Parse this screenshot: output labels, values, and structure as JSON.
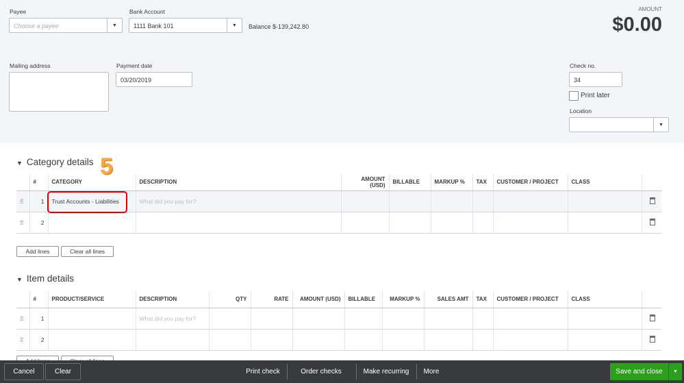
{
  "header": {
    "payee_label": "Payee",
    "payee_placeholder": "Choose a payee",
    "bank_label": "Bank Account",
    "bank_value": "1111 Bank 101",
    "balance": "Balance $-139,242.80",
    "amount_label": "AMOUNT",
    "amount": "$0.00",
    "mailing_label": "Mailing address",
    "date_label": "Payment date",
    "date_value": "03/20/2019",
    "checkno_label": "Check no.",
    "checkno_value": "34",
    "print_later": "Print later",
    "location_label": "Location"
  },
  "category": {
    "title": "Category details",
    "annotation": "5",
    "columns": [
      "",
      "#",
      "CATEGORY",
      "DESCRIPTION",
      "AMOUNT (USD)",
      "BILLABLE",
      "MARKUP %",
      "TAX",
      "CUSTOMER / PROJECT",
      "CLASS",
      ""
    ],
    "rows": [
      {
        "num": "1",
        "category": "Trust Accounts - Liabilities",
        "description_placeholder": "What did you pay for?"
      },
      {
        "num": "2",
        "category": "",
        "description_placeholder": ""
      }
    ],
    "add_lines": "Add lines",
    "clear_lines": "Clear all lines"
  },
  "items": {
    "title": "Item details",
    "columns": [
      "",
      "#",
      "PRODUCT/SERVICE",
      "DESCRIPTION",
      "QTY",
      "RATE",
      "AMOUNT (USD)",
      "BILLABLE",
      "MARKUP %",
      "SALES AMT",
      "TAX",
      "CUSTOMER / PROJECT",
      "CLASS",
      ""
    ],
    "rows": [
      {
        "num": "1",
        "description_placeholder": "What did you pay for?"
      },
      {
        "num": "2",
        "description_placeholder": ""
      }
    ],
    "add_lines": "Add lines",
    "clear_lines": "Clear all lines"
  },
  "footer": {
    "cancel": "Cancel",
    "clear": "Clear",
    "print_check": "Print check",
    "order_checks": "Order checks",
    "make_recurring": "Make recurring",
    "more": "More",
    "save_close": "Save and close"
  }
}
